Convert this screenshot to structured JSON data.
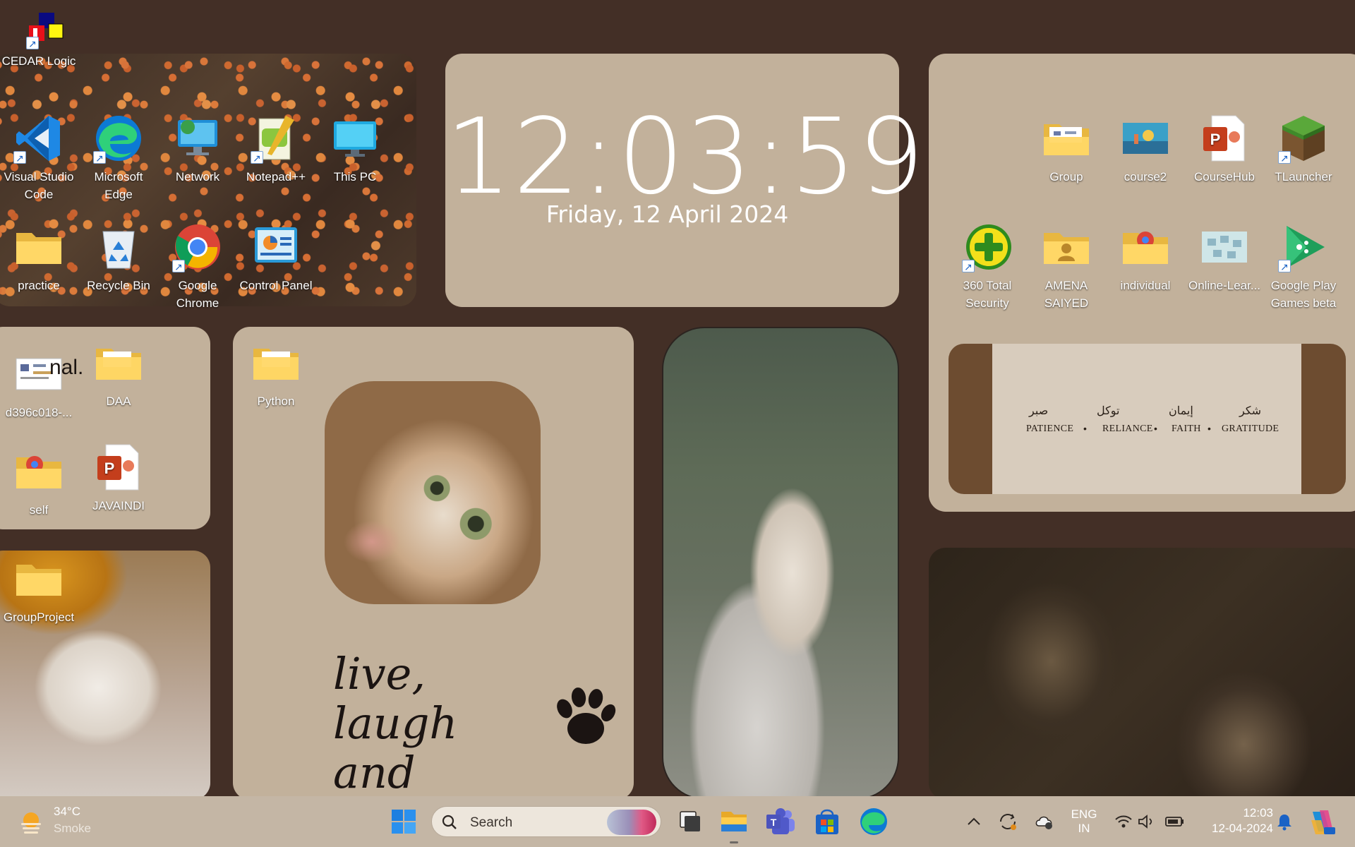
{
  "desktop": {
    "clock": {
      "time": "12:03:59",
      "date": "Friday, 12 April 2024"
    },
    "quote": {
      "arabic": [
        "صبر",
        "توكل",
        "إيمان",
        "شكر"
      ],
      "english": [
        "PATIENCE",
        "RELIANCE",
        "FAITH",
        "GRATITUDE"
      ]
    },
    "handwriting": {
      "line1": "live, laugh",
      "line2": "and meow"
    },
    "icons": {
      "cedar": "CEDAR Logic",
      "vscode": "Visual Studio Code",
      "edge": "Microsoft Edge",
      "network": "Network",
      "notepadpp": "Notepad++",
      "thispc": "This PC",
      "practice": "practice",
      "recycle": "Recycle Bin",
      "chrome": "Google Chrome",
      "controlpanel": "Control Panel",
      "d396": "d396c018-...",
      "daa": "DAA",
      "self": "self",
      "javaindi": "JAVAINDI",
      "python": "Python",
      "groupproject": "GroupProject",
      "group": "Group",
      "course2": "course2",
      "coursehub": "CourseHub",
      "tlauncher": "TLauncher",
      "security360": "360 Total Security",
      "amena": "AMENA SAIYED",
      "individual": "individual",
      "onlinelearn": "Online-Lear...",
      "playgames": "Google Play Games beta"
    },
    "overlay_text": "nal."
  },
  "taskbar": {
    "weather": {
      "temp": "34°C",
      "desc": "Smoke"
    },
    "search_placeholder": "Search",
    "language": {
      "line1": "ENG",
      "line2": "IN"
    },
    "time": "12:03",
    "date": "12-04-2024"
  },
  "colors": {
    "background": "#432f26",
    "panel": "#c2b19b",
    "taskbar": "#c4b6a5"
  }
}
